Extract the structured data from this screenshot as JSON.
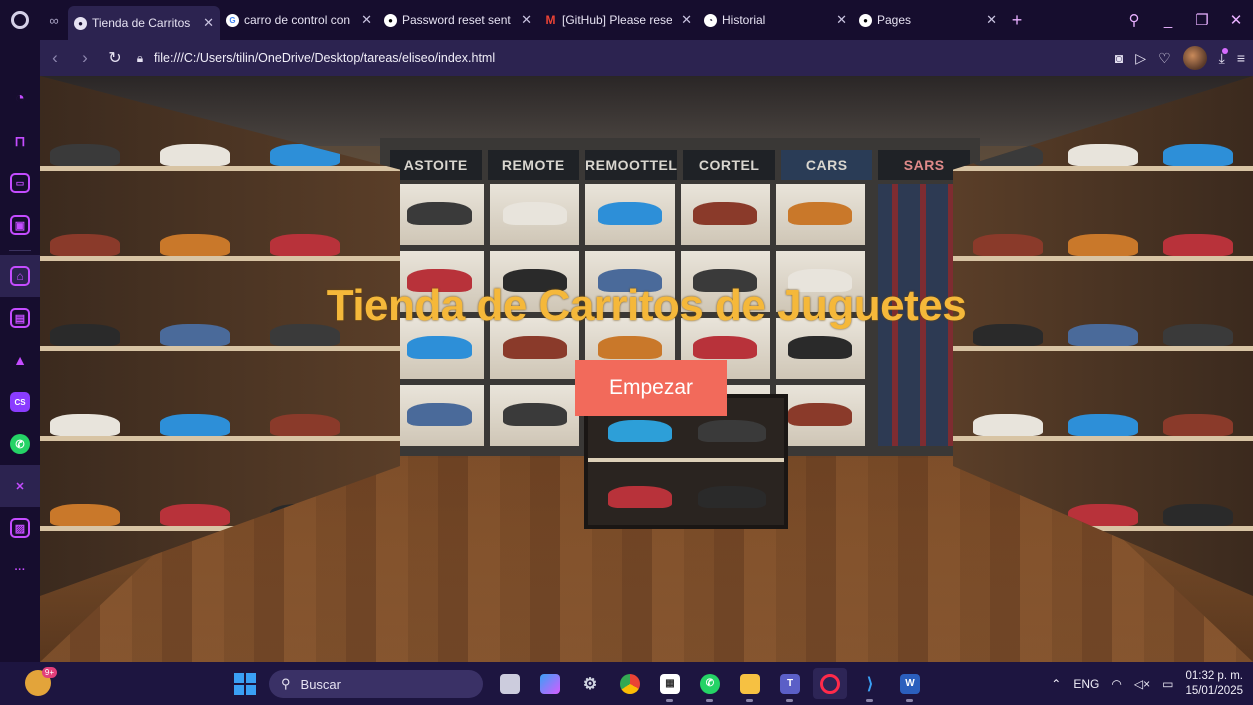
{
  "browser": {
    "tabs": [
      {
        "title": "Tienda de Carritos d",
        "favicon": "page-icon",
        "active": true
      },
      {
        "title": "carro de control con",
        "favicon": "google-icon",
        "active": false
      },
      {
        "title": "Password reset sent",
        "favicon": "github-icon",
        "active": false
      },
      {
        "title": "[GitHub] Please rese",
        "favicon": "gmail-icon",
        "active": false
      },
      {
        "title": "Historial",
        "favicon": "history-icon",
        "active": false
      },
      {
        "title": "Pages",
        "favicon": "github-icon",
        "active": false
      }
    ],
    "url": "file:///C:/Users/tilin/OneDrive/Desktop/tareas/eliseo/index.html"
  },
  "page": {
    "title": "Tienda de Carritos de Juguetes",
    "start_button": "Empezar",
    "signs": [
      "ASTOITE",
      "REMOTE",
      "REMOOTTEL",
      "CORTEL",
      "CARS",
      "SARS"
    ]
  },
  "taskbar": {
    "search_label": "Buscar",
    "weather_badge": "9+",
    "language": "ENG",
    "time": "01:32 p. m.",
    "date": "15/01/2025"
  },
  "colors": {
    "accent": "#c44cff",
    "title": "#f5b83a",
    "button": "#f26a5b"
  }
}
